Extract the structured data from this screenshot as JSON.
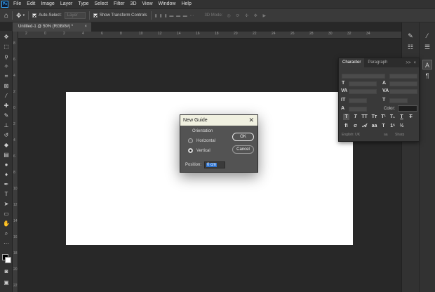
{
  "menubar": {
    "logo": "Ps",
    "items": [
      "File",
      "Edit",
      "Image",
      "Layer",
      "Type",
      "Select",
      "Filter",
      "3D",
      "View",
      "Window",
      "Help"
    ]
  },
  "options": {
    "auto_select_label": "Auto-Select:",
    "layer_value": "Layer",
    "show_transform_label": "Show Transform Controls",
    "mode_3d_label": "3D Mode:"
  },
  "document": {
    "tab_title": "Untitled-1 @ 50% (RGB/8#) *",
    "tab_close": "×"
  },
  "ruler_top": [
    "2",
    "0",
    "2",
    "4",
    "6",
    "8",
    "10",
    "12",
    "14",
    "16",
    "18",
    "20",
    "22",
    "24",
    "26",
    "28",
    "30",
    "32",
    "34"
  ],
  "ruler_left": [
    "8",
    "6",
    "4",
    "2",
    "0",
    "2",
    "4",
    "6",
    "8",
    "10",
    "12",
    "14",
    "16",
    "18",
    "20",
    "22"
  ],
  "character_panel": {
    "tabs": [
      "Character",
      "Paragraph"
    ],
    "menu_glyph": ">>",
    "close_glyph": "×",
    "color_label": "Color:",
    "language": "English: UK",
    "antialias": "Sharp"
  },
  "dialog": {
    "title": "New Guide",
    "close": "✕",
    "orientation_label": "Orientation",
    "horizontal_label": "Horizontal",
    "vertical_label": "Vertical",
    "selected": "Vertical",
    "position_label": "Position:",
    "position_value": "0 cm",
    "ok_label": "OK",
    "cancel_label": "Cancel"
  },
  "colors": {
    "accent_blue": "#31a8ff",
    "canvas": "#ffffff",
    "workspace": "#282828"
  }
}
